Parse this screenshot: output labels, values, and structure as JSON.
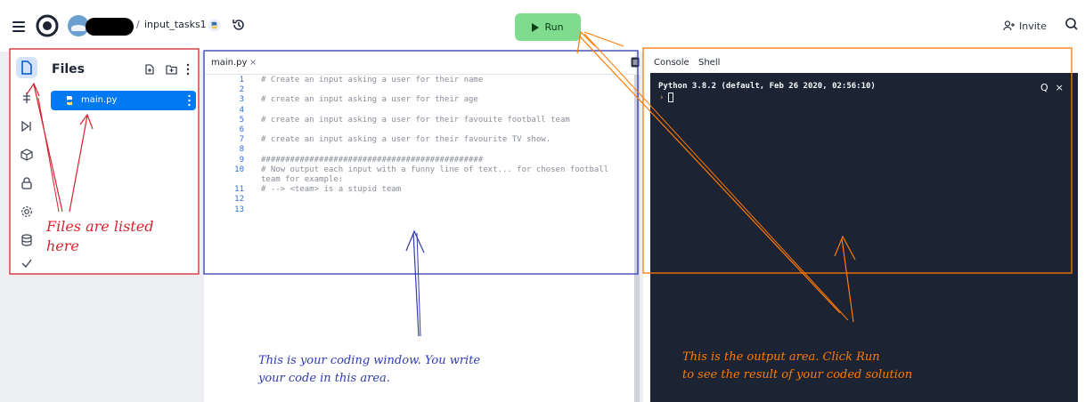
{
  "header": {
    "repo_name": "input_tasks1",
    "separator": "/",
    "run_label": "Run",
    "invite_label": "Invite"
  },
  "sidebar": {
    "title": "Files",
    "tools": [
      "files",
      "packages",
      "debugger",
      "extensions",
      "secrets",
      "settings",
      "database",
      "check"
    ],
    "files": [
      {
        "name": "main.py"
      }
    ]
  },
  "editor": {
    "tab_name": "main.py",
    "tab_close": "×",
    "lines": [
      {
        "num": "1",
        "text": "# Create an input asking a user for their name"
      },
      {
        "num": "2",
        "text": ""
      },
      {
        "num": "3",
        "text": "# create an input asking a user for their age"
      },
      {
        "num": "4",
        "text": ""
      },
      {
        "num": "5",
        "text": "# create an input asking a user for their favouite football team"
      },
      {
        "num": "6",
        "text": ""
      },
      {
        "num": "7",
        "text": "# create an input asking a user for their favourite TV show."
      },
      {
        "num": "8",
        "text": ""
      },
      {
        "num": "9",
        "text": "##############################################"
      },
      {
        "num": "10",
        "text": "# Now output each input with a funny line of text... for chosen football"
      },
      {
        "num": "",
        "text": "team for example:"
      },
      {
        "num": "11",
        "text": "# --> <team> is a stupid team"
      },
      {
        "num": "12",
        "text": ""
      },
      {
        "num": "13",
        "text": ""
      }
    ]
  },
  "console": {
    "tabs": [
      "Console",
      "Shell"
    ],
    "banner": "Python 3.8.2 (default, Feb 26 2020, 02:56:10)",
    "prompt": "›",
    "search_glyph": "Q",
    "close_glyph": "×"
  },
  "annotations": {
    "files_note_line1": "Files are listed",
    "files_note_line2": "here",
    "code_note_line1": "This is your coding window. You write",
    "code_note_line2": "your code in this area.",
    "output_note_line1": "This is the output area. Click Run",
    "output_note_line2": "to see the result of your coded solution"
  },
  "colors": {
    "run_button": "#7fdc8e",
    "active_file": "#0079f2",
    "terminal_bg": "#1c2333",
    "annotation_red": "#d4242e",
    "annotation_blue": "#2f3ab5",
    "annotation_orange": "#ff7a00"
  }
}
